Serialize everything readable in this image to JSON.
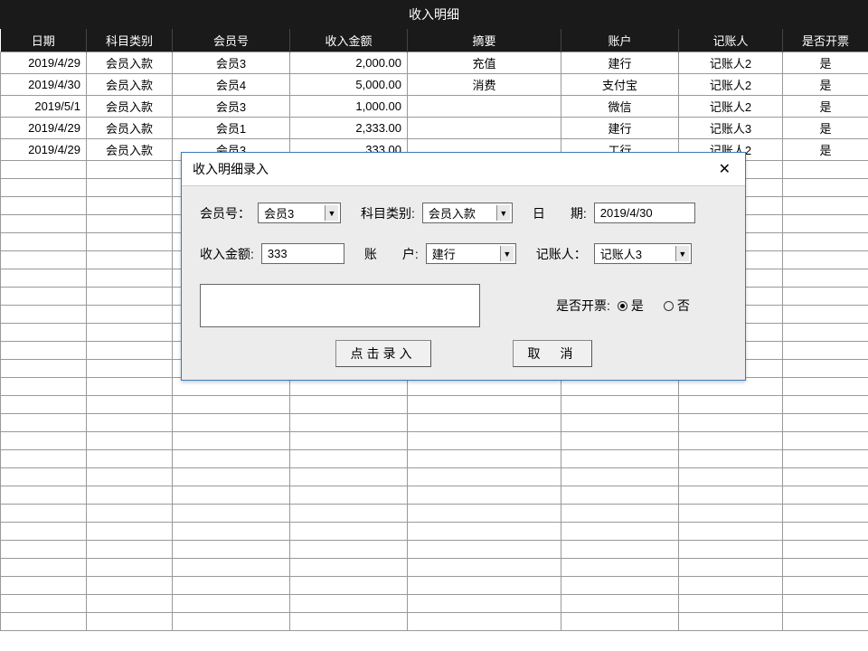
{
  "page_title": "收入明细",
  "columns": [
    "日期",
    "科目类别",
    "会员号",
    "收入金额",
    "摘要",
    "账户",
    "记账人",
    "是否开票"
  ],
  "rows": [
    {
      "date": "2019/4/29",
      "cat": "会员入款",
      "member": "会员3",
      "amount": "2,000.00",
      "summary": "充值",
      "account": "建行",
      "booker": "记账人2",
      "invoice": "是"
    },
    {
      "date": "2019/4/30",
      "cat": "会员入款",
      "member": "会员4",
      "amount": "5,000.00",
      "summary": "消费",
      "account": "支付宝",
      "booker": "记账人2",
      "invoice": "是"
    },
    {
      "date": "2019/5/1",
      "cat": "会员入款",
      "member": "会员3",
      "amount": "1,000.00",
      "summary": "",
      "account": "微信",
      "booker": "记账人2",
      "invoice": "是"
    },
    {
      "date": "2019/4/29",
      "cat": "会员入款",
      "member": "会员1",
      "amount": "2,333.00",
      "summary": "",
      "account": "建行",
      "booker": "记账人3",
      "invoice": "是"
    },
    {
      "date": "2019/4/29",
      "cat": "会员入款",
      "member": "会员3",
      "amount": "333.00",
      "summary": "",
      "account": "工行",
      "booker": "记账人2",
      "invoice": "是"
    }
  ],
  "empty_row_count": 26,
  "dialog": {
    "title": "收入明细录入",
    "labels": {
      "member": "会员号：",
      "category": "科目类别:",
      "date": "日　　期:",
      "amount": "收入金额:",
      "account": "账　　户:",
      "booker": "记账人：",
      "invoice": "是否开票:",
      "yes": "是",
      "no": "否"
    },
    "values": {
      "member": "会员3",
      "category": "会员入款",
      "date": "2019/4/30",
      "amount": "333",
      "account": "建行",
      "booker": "记账人3",
      "invoice_selected": "yes"
    },
    "buttons": {
      "submit": "点击录入",
      "cancel": "取　消"
    }
  }
}
